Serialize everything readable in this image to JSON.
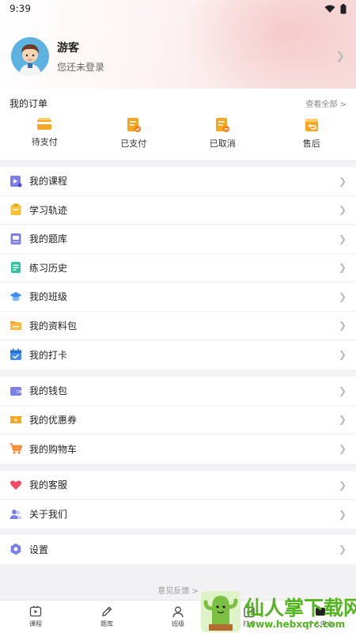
{
  "status": {
    "time": "9:39"
  },
  "profile": {
    "name": "游客",
    "subtitle": "您还未登录"
  },
  "orders": {
    "title": "我的订单",
    "view_all": "查看全部 >",
    "items": [
      {
        "label": "待支付",
        "icon": "wallet-pending-icon"
      },
      {
        "label": "已支付",
        "icon": "paid-document-icon"
      },
      {
        "label": "已取消",
        "icon": "cancelled-document-icon"
      },
      {
        "label": "售后",
        "icon": "after-sales-return-icon"
      }
    ]
  },
  "menu1": [
    {
      "label": "我的课程",
      "icon": "course-play-icon"
    },
    {
      "label": "学习轨迹",
      "icon": "clipboard-icon"
    },
    {
      "label": "我的题库",
      "icon": "question-bank-icon"
    },
    {
      "label": "练习历史",
      "icon": "practice-history-icon"
    },
    {
      "label": "我的班级",
      "icon": "graduation-cap-icon"
    },
    {
      "label": "我的资料包",
      "icon": "folder-icon"
    },
    {
      "label": "我的打卡",
      "icon": "calendar-check-icon"
    }
  ],
  "menu2": [
    {
      "label": "我的钱包",
      "icon": "wallet-icon"
    },
    {
      "label": "我的优惠券",
      "icon": "coupon-icon"
    },
    {
      "label": "我的购物车",
      "icon": "cart-icon"
    }
  ],
  "menu3": [
    {
      "label": "我的客服",
      "icon": "heart-icon"
    },
    {
      "label": "关于我们",
      "icon": "people-icon"
    }
  ],
  "menu4": [
    {
      "label": "设置",
      "icon": "settings-hex-icon"
    }
  ],
  "feedback": "意见反馈 >",
  "tabs": [
    {
      "label": "课程",
      "icon": "play-tv-icon"
    },
    {
      "label": "题库",
      "icon": "pencil-icon"
    },
    {
      "label": "班级",
      "icon": "person-icon"
    },
    {
      "label": "打卡",
      "icon": "checkin-icon"
    },
    {
      "label": "个人中心",
      "icon": "profile-icon"
    }
  ],
  "watermark": {
    "text": "仙人掌下载网",
    "url": "www.hebxqrc.com"
  }
}
